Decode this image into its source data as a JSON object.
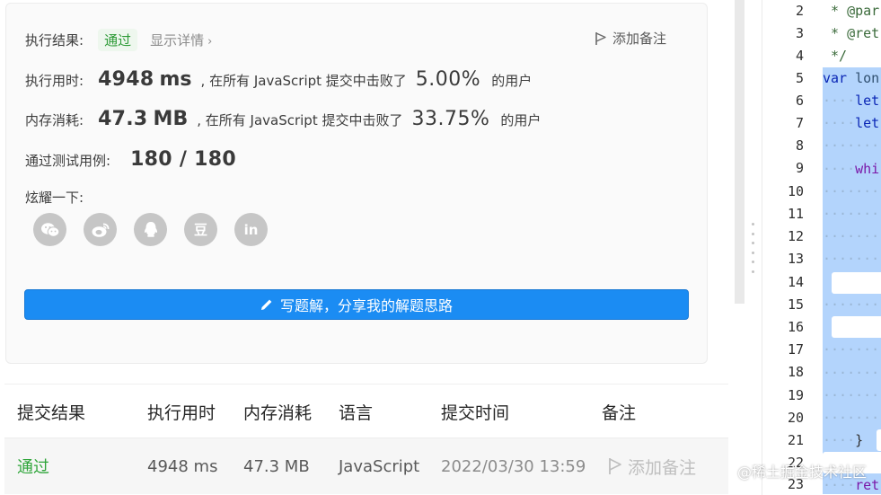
{
  "result": {
    "exec_result_label": "执行结果:",
    "status": "通过",
    "details": "显示详情",
    "add_note": "添加备注",
    "runtime_label": "执行用时:",
    "runtime_value": "4948",
    "runtime_unit": "ms",
    "mem_label": "内存消耗:",
    "mem_value": "47.3",
    "mem_unit": "MB",
    "beat_prefix": ", 在所有 JavaScript 提交中击败了",
    "runtime_pct": "5.00%",
    "mem_pct": "33.75%",
    "users_suffix": "的用户",
    "tests_label": "通过测试用例:",
    "tests_value": "180 / 180",
    "share_label": "炫耀一下:",
    "share_icons": [
      "wechat-icon",
      "weibo-icon",
      "qq-icon",
      "douban-icon",
      "linkedin-icon"
    ],
    "douban_glyph": "豆",
    "linkedin_glyph": "in",
    "solution_button": "写题解，分享我的解题思路"
  },
  "table": {
    "headers": [
      "提交结果",
      "执行用时",
      "内存消耗",
      "语言",
      "提交时间",
      "备注"
    ],
    "row": {
      "result": "通过",
      "runtime": "4948 ms",
      "memory": "47.3 MB",
      "language": "JavaScript",
      "time": "2022/03/30 13:59",
      "note": "添加备注"
    }
  },
  "editor": {
    "line_numbers": [
      "2",
      "3",
      "4",
      "5",
      "6",
      "7",
      "8",
      "9",
      "10",
      "11",
      "12",
      "13",
      "14",
      "15",
      "16",
      "17",
      "18",
      "19",
      "20",
      "21",
      "22",
      "23"
    ],
    "lines": {
      "l2": " * @par",
      "l3": " * @ret",
      "l4": " */",
      "l5a": "var",
      "l5b": " lon",
      "l6": "let",
      "l7": "let",
      "l9": "whi",
      "l21": "}",
      "l23": "ret"
    }
  },
  "watermark": "@稀土掘金技术社区",
  "colors": {
    "primary": "#1b8cf3",
    "success": "#2c9a35",
    "selection": "#b3d4fc"
  }
}
